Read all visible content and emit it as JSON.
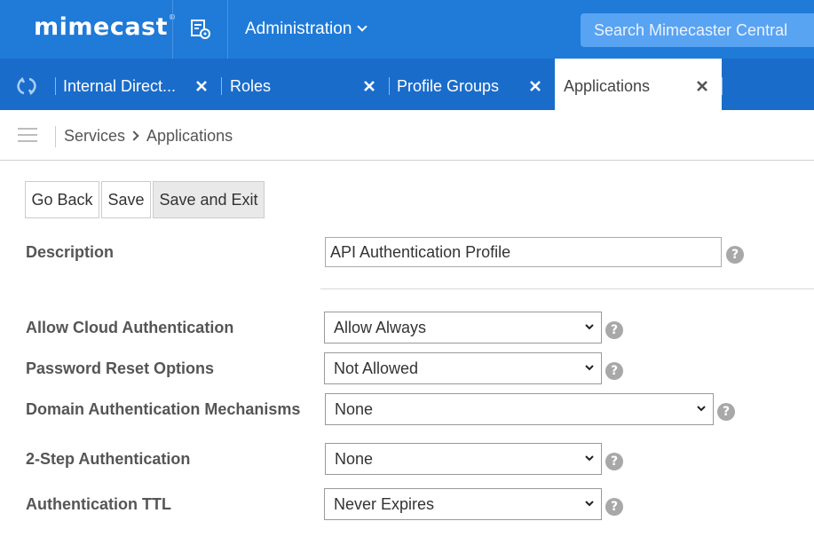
{
  "header": {
    "logo": "mimecast",
    "logo_tm": "®",
    "admin_menu": "Administration",
    "search_placeholder": "Search Mimecaster Central"
  },
  "tabs": [
    {
      "label": "Internal Direct...",
      "active": false
    },
    {
      "label": "Roles",
      "active": false
    },
    {
      "label": "Profile Groups",
      "active": false
    },
    {
      "label": "Applications",
      "active": true
    }
  ],
  "breadcrumb": {
    "root": "Services",
    "current": "Applications"
  },
  "buttons": {
    "go_back": "Go Back",
    "save": "Save",
    "save_exit": "Save and Exit"
  },
  "form": {
    "description": {
      "label": "Description",
      "value": "API Authentication Profile"
    },
    "cloud_auth": {
      "label": "Allow Cloud Authentication",
      "value": "Allow Always"
    },
    "password_reset": {
      "label": "Password Reset Options",
      "value": "Not Allowed"
    },
    "domain_auth": {
      "label": "Domain Authentication Mechanisms",
      "value": "None"
    },
    "two_step": {
      "label": "2-Step Authentication",
      "value": "None"
    },
    "ttl": {
      "label": "Authentication TTL",
      "value": "Never Expires"
    }
  },
  "help_glyph": "?",
  "colors": {
    "topbar": "#1f7ad8",
    "tabbar": "#1a6ccb",
    "search": "#59a3f3",
    "help": "#a8a8a8"
  },
  "icons": [
    "app-settings-icon",
    "chevron-down-icon",
    "refresh-icon",
    "close-icon",
    "hamburger-icon",
    "chevron-right-icon",
    "help-icon"
  ]
}
